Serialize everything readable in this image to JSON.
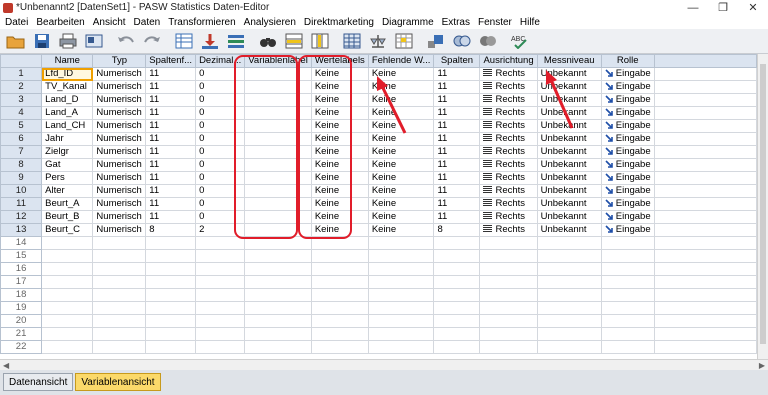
{
  "window": {
    "title": "*Unbenannt2 [DatenSet1] - PASW Statistics Daten-Editor",
    "minimize": "—",
    "restore": "❐",
    "close": "✕"
  },
  "menu": [
    "Datei",
    "Bearbeiten",
    "Ansicht",
    "Daten",
    "Transformieren",
    "Analysieren",
    "Direktmarketing",
    "Diagramme",
    "Extras",
    "Fenster",
    "Hilfe"
  ],
  "toolbar": {
    "icons": [
      "open-folder-icon",
      "save-icon",
      "print-icon",
      "dialog-recall-icon",
      "undo-icon",
      "redo-icon",
      "goto-case-icon",
      "goto-variable-icon",
      "variables-icon",
      "find-icon",
      "insert-cases-icon",
      "insert-variable-icon",
      "split-file-icon",
      "weight-cases-icon",
      "select-cases-icon",
      "value-labels-icon",
      "use-sets-icon",
      "show-all-icon",
      "spell-check-icon"
    ]
  },
  "grid": {
    "headers": [
      "Name",
      "Typ",
      "Spaltenf...",
      "Dezimal...",
      "Variablenlabel",
      "Wertelabels",
      "Fehlende W...",
      "Spalten",
      "Ausrichtung",
      "Messniveau",
      "Rolle"
    ],
    "rows": [
      {
        "num": "1",
        "name": "Lfd_ID",
        "typ": "Numerisch",
        "spaltenf": "11",
        "dezimal": "0",
        "varlabel": "",
        "wertelabels": "Keine",
        "fehlende": "Keine",
        "spalten": "11",
        "ausrichtung": "Rechts",
        "messniveau": "Unbekannt",
        "rolle": "Eingabe"
      },
      {
        "num": "2",
        "name": "TV_Kanal",
        "typ": "Numerisch",
        "spaltenf": "11",
        "dezimal": "0",
        "varlabel": "",
        "wertelabels": "Keine",
        "fehlende": "Keine",
        "spalten": "11",
        "ausrichtung": "Rechts",
        "messniveau": "Unbekannt",
        "rolle": "Eingabe"
      },
      {
        "num": "3",
        "name": "Land_D",
        "typ": "Numerisch",
        "spaltenf": "11",
        "dezimal": "0",
        "varlabel": "",
        "wertelabels": "Keine",
        "fehlende": "Keine",
        "spalten": "11",
        "ausrichtung": "Rechts",
        "messniveau": "Unbekannt",
        "rolle": "Eingabe"
      },
      {
        "num": "4",
        "name": "Land_A",
        "typ": "Numerisch",
        "spaltenf": "11",
        "dezimal": "0",
        "varlabel": "",
        "wertelabels": "Keine",
        "fehlende": "Keine",
        "spalten": "11",
        "ausrichtung": "Rechts",
        "messniveau": "Unbekannt",
        "rolle": "Eingabe"
      },
      {
        "num": "5",
        "name": "Land_CH",
        "typ": "Numerisch",
        "spaltenf": "11",
        "dezimal": "0",
        "varlabel": "",
        "wertelabels": "Keine",
        "fehlende": "Keine",
        "spalten": "11",
        "ausrichtung": "Rechts",
        "messniveau": "Unbekannt",
        "rolle": "Eingabe"
      },
      {
        "num": "6",
        "name": "Jahr",
        "typ": "Numerisch",
        "spaltenf": "11",
        "dezimal": "0",
        "varlabel": "",
        "wertelabels": "Keine",
        "fehlende": "Keine",
        "spalten": "11",
        "ausrichtung": "Rechts",
        "messniveau": "Unbekannt",
        "rolle": "Eingabe"
      },
      {
        "num": "7",
        "name": "Zielgr",
        "typ": "Numerisch",
        "spaltenf": "11",
        "dezimal": "0",
        "varlabel": "",
        "wertelabels": "Keine",
        "fehlende": "Keine",
        "spalten": "11",
        "ausrichtung": "Rechts",
        "messniveau": "Unbekannt",
        "rolle": "Eingabe"
      },
      {
        "num": "8",
        "name": "Gat",
        "typ": "Numerisch",
        "spaltenf": "11",
        "dezimal": "0",
        "varlabel": "",
        "wertelabels": "Keine",
        "fehlende": "Keine",
        "spalten": "11",
        "ausrichtung": "Rechts",
        "messniveau": "Unbekannt",
        "rolle": "Eingabe"
      },
      {
        "num": "9",
        "name": "Pers",
        "typ": "Numerisch",
        "spaltenf": "11",
        "dezimal": "0",
        "varlabel": "",
        "wertelabels": "Keine",
        "fehlende": "Keine",
        "spalten": "11",
        "ausrichtung": "Rechts",
        "messniveau": "Unbekannt",
        "rolle": "Eingabe"
      },
      {
        "num": "10",
        "name": "Alter",
        "typ": "Numerisch",
        "spaltenf": "11",
        "dezimal": "0",
        "varlabel": "",
        "wertelabels": "Keine",
        "fehlende": "Keine",
        "spalten": "11",
        "ausrichtung": "Rechts",
        "messniveau": "Unbekannt",
        "rolle": "Eingabe"
      },
      {
        "num": "11",
        "name": "Beurt_A",
        "typ": "Numerisch",
        "spaltenf": "11",
        "dezimal": "0",
        "varlabel": "",
        "wertelabels": "Keine",
        "fehlende": "Keine",
        "spalten": "11",
        "ausrichtung": "Rechts",
        "messniveau": "Unbekannt",
        "rolle": "Eingabe"
      },
      {
        "num": "12",
        "name": "Beurt_B",
        "typ": "Numerisch",
        "spaltenf": "11",
        "dezimal": "0",
        "varlabel": "",
        "wertelabels": "Keine",
        "fehlende": "Keine",
        "spalten": "11",
        "ausrichtung": "Rechts",
        "messniveau": "Unbekannt",
        "rolle": "Eingabe"
      },
      {
        "num": "13",
        "name": "Beurt_C",
        "typ": "Numerisch",
        "spaltenf": "8",
        "dezimal": "2",
        "varlabel": "",
        "wertelabels": "Keine",
        "fehlende": "Keine",
        "spalten": "8",
        "ausrichtung": "Rechts",
        "messniveau": "Unbekannt",
        "rolle": "Eingabe"
      }
    ],
    "empty_rows": [
      "14",
      "15",
      "16",
      "17",
      "18",
      "19",
      "20",
      "21",
      "22"
    ]
  },
  "tabs": {
    "data_view": "Datenansicht",
    "variable_view": "Variablenansicht"
  },
  "colors": {
    "annotation": "#e11d2a",
    "active_tab": "#fbd96a",
    "header_bg": "#dbe4f0"
  }
}
